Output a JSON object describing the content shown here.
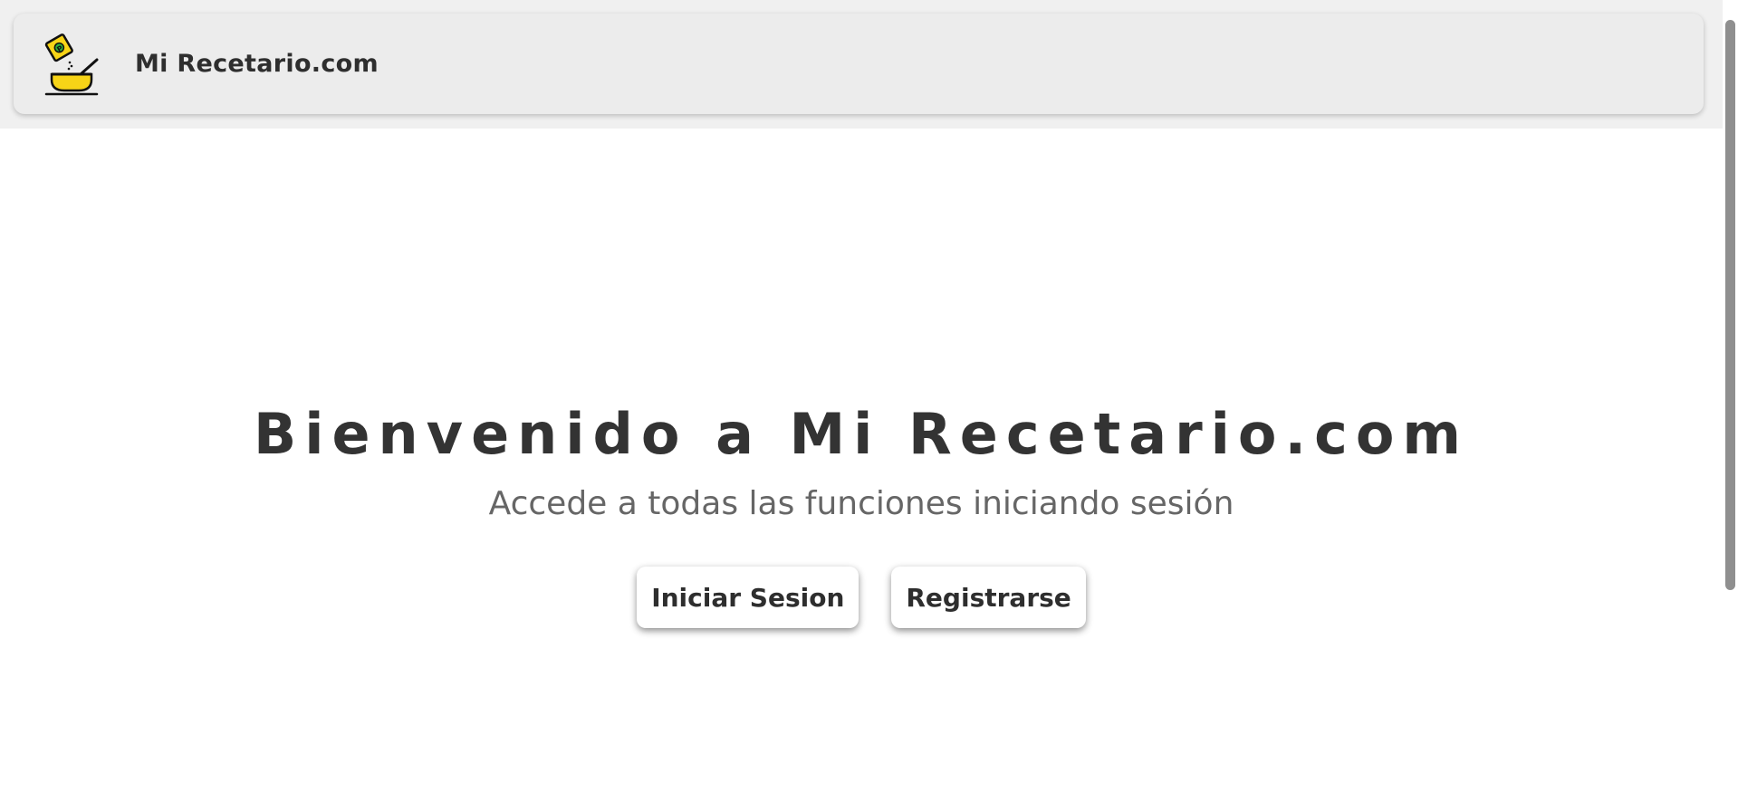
{
  "header": {
    "brand": "Mi Recetario.com",
    "logo_icon": "cooking-bowl-icon",
    "logo_colors": {
      "bowl": "#f7d417",
      "packet": "#f7d417",
      "outline": "#111111",
      "leaf": "#2fae3b"
    }
  },
  "hero": {
    "title": "Bienvenido a Mi Recetario.com",
    "subtitle": "Accede a todas las funciones iniciando sesión"
  },
  "actions": {
    "login_label": "Iniciar Sesion",
    "register_label": "Registrarse"
  },
  "colors": {
    "header_bg": "#ececec",
    "title_text": "#333333",
    "subtitle_text": "#666666",
    "button_bg": "#ffffff"
  }
}
